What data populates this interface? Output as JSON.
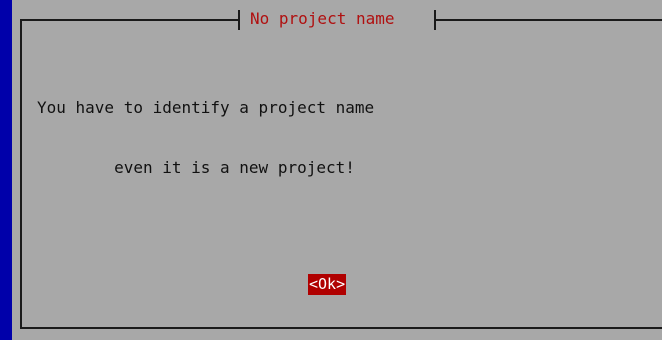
{
  "dialog": {
    "title": "No project name",
    "message_lines": [
      "You have to identify a project name",
      "        even it is a new project!"
    ],
    "ok_label": "<Ok>"
  },
  "colors": {
    "terminal_background": "#0000aa",
    "dialog_background": "#a8a8a8",
    "title_text": "#b01010",
    "button_background": "#b00000",
    "button_text": "#ffffff",
    "frame": "#1a1a1a"
  }
}
